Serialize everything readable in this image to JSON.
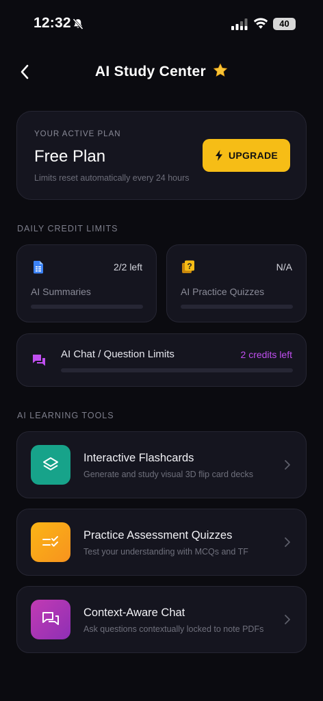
{
  "status_bar": {
    "time": "12:32",
    "battery": "40"
  },
  "header": {
    "title": "AI Study Center",
    "star_icon": "star-emoji-icon"
  },
  "plan": {
    "eyebrow": "YOUR ACTIVE PLAN",
    "name": "Free Plan",
    "note": "Limits reset automatically every 24 hours",
    "upgrade_label": "UPGRADE"
  },
  "credits": {
    "section_label": "DAILY CREDIT LIMITS",
    "summaries": {
      "title": "AI Summaries",
      "value": "2/2 left",
      "icon": "document-icon",
      "progress": 0
    },
    "quizzes": {
      "title": "AI Practice Quizzes",
      "value": "N/A",
      "icon": "quiz-icon",
      "progress": 0
    },
    "chat": {
      "title": "AI Chat / Question Limits",
      "value": "2 credits left",
      "icon": "chat-icon",
      "progress": 0
    }
  },
  "tools": {
    "section_label": "AI LEARNING TOOLS",
    "items": [
      {
        "title": "Interactive Flashcards",
        "desc": "Generate and study visual 3D flip card decks",
        "icon": "layers-icon",
        "color": "#17a38a"
      },
      {
        "title": "Practice Assessment Quizzes",
        "desc": "Test your understanding with MCQs and TF",
        "icon": "checklist-icon",
        "color": "#f7a21a"
      },
      {
        "title": "Context-Aware Chat",
        "desc": "Ask questions contextually locked to note PDFs",
        "icon": "chat-bubbles-icon",
        "color": "#b13bb8"
      }
    ]
  },
  "colors": {
    "background": "#0b0b10",
    "card": "#15151f",
    "accent_yellow": "#f6bd16",
    "accent_purple": "#c04ff0",
    "accent_blue": "#3b82f6"
  }
}
